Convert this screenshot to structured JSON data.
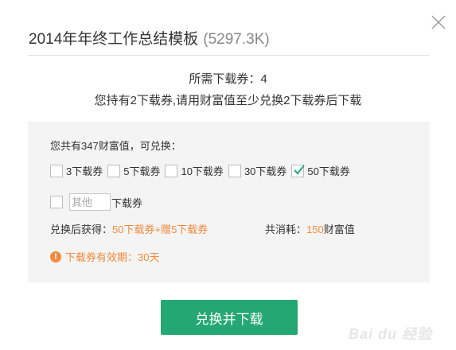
{
  "dialog": {
    "title": "2014年年终工作总结模板",
    "file_size": "(5297.3K)",
    "need_text": "所需下载券：4",
    "have_text": "您持有2下载券,请用财富值至少兑换2下载券后下载"
  },
  "exchange": {
    "balance_text": "您共有347财富值，可兑换：",
    "options": [
      {
        "label": "3下载券",
        "checked": false
      },
      {
        "label": "5下载券",
        "checked": false
      },
      {
        "label": "10下载券",
        "checked": false
      },
      {
        "label": "30下载券",
        "checked": false
      },
      {
        "label": "50下载券",
        "checked": true
      }
    ],
    "other_placeholder": "其他",
    "other_unit": "下载券",
    "obtain_prefix": "兑换后获得：",
    "obtain_amount": "50下载券+赠5下载券",
    "consume_prefix": "共消耗：",
    "consume_amount": "150",
    "consume_unit": "财富值",
    "validity_text": "下载券有效期：30天"
  },
  "actions": {
    "submit_label": "兑换并下载"
  },
  "watermark": {
    "text": "Bai du 经验"
  },
  "colors": {
    "accent_green": "#25a774",
    "orange": "#f08a3c",
    "panel_bg": "#f4f4f4"
  }
}
